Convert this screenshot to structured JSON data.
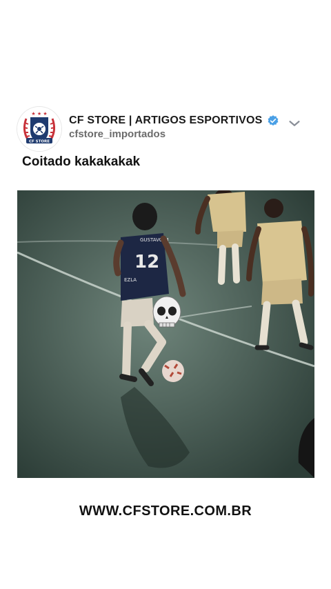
{
  "account": {
    "name": "CF STORE | ARTIGOS ESPORTIVOS",
    "handle": "cfstore_importados",
    "verified": true,
    "logo_text": "CF STORE"
  },
  "post": {
    "caption": "Coitado kakakakak",
    "jersey_name": "GUSTAVO M",
    "jersey_number": "12",
    "sponsor": "EZLA"
  },
  "footer": {
    "url": "WWW.CFSTORE.COM.BR"
  },
  "colors": {
    "verified": "#4aa0e6",
    "court": "#3d544c",
    "text": "#111111",
    "handle": "#6b6b6b"
  },
  "icons": [
    "verified-badge-icon",
    "chevron-down-icon",
    "skull-emoji-icon",
    "soccer-ball-icon"
  ]
}
